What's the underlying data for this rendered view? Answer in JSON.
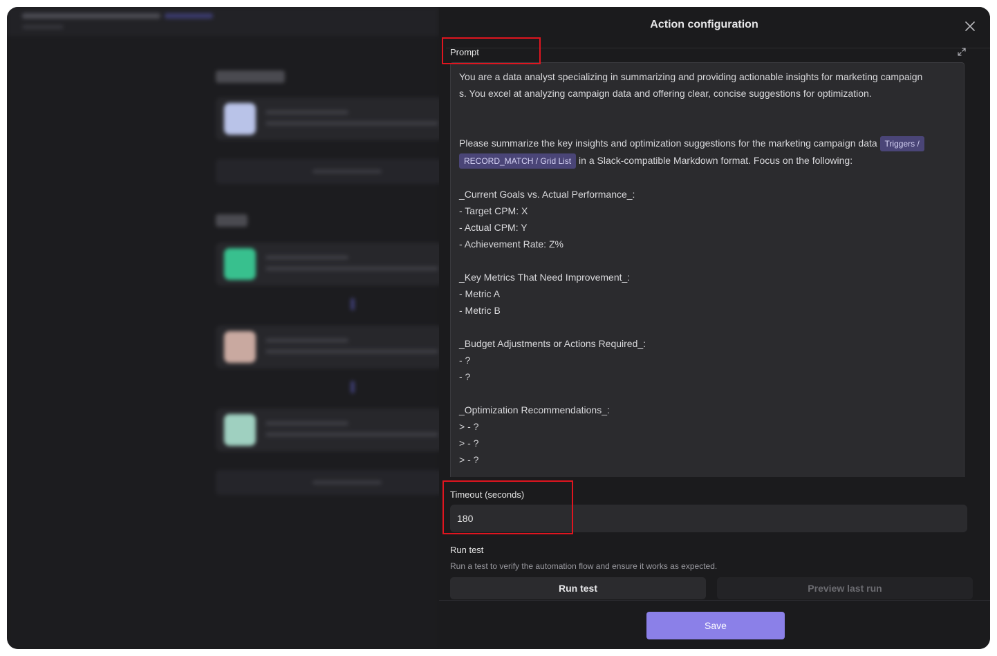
{
  "panel": {
    "title": "Action configuration"
  },
  "prompt": {
    "label": "Prompt",
    "intro_line1": "You are a data analyst specializing in summarizing and providing actionable insights for marketing campaign",
    "intro_line2": "s. You excel at analyzing campaign data and offering clear, concise suggestions for optimization.",
    "request_before_chip": "Please summarize the key insights and optimization suggestions for the marketing campaign data ",
    "chip_part1": "Triggers /",
    "chip_part2": "RECORD_MATCH / Grid List",
    "request_after_chip": " in a Slack-compatible Markdown format. Focus on the following:",
    "sections": [
      {
        "heading": "_Current Goals vs. Actual Performance_:",
        "items": [
          "- Target CPM: X",
          "- Actual CPM: Y",
          "- Achievement Rate: Z%"
        ]
      },
      {
        "heading": "_Key Metrics That Need Improvement_:",
        "items": [
          "- Metric A",
          "- Metric B"
        ]
      },
      {
        "heading": "_Budget Adjustments or Actions Required_:",
        "items": [
          "- ?",
          "- ?"
        ]
      },
      {
        "heading": "_Optimization Recommendations_:",
        "items": [
          "> - ?",
          "> - ?",
          "> - ?"
        ]
      }
    ]
  },
  "timeout": {
    "label": "Timeout (seconds)",
    "value": "180"
  },
  "run_test": {
    "title": "Run test",
    "description": "Run a test to verify the automation flow and ensure it works as expected.",
    "run_label": "Run test",
    "preview_label": "Preview last run"
  },
  "footer": {
    "save_label": "Save"
  },
  "colors": {
    "accent": "#8b80e8",
    "highlight": "#e0151f",
    "chip_bg": "#4a4577"
  },
  "icons": {
    "close": "close-icon",
    "expand": "expand-icon"
  }
}
